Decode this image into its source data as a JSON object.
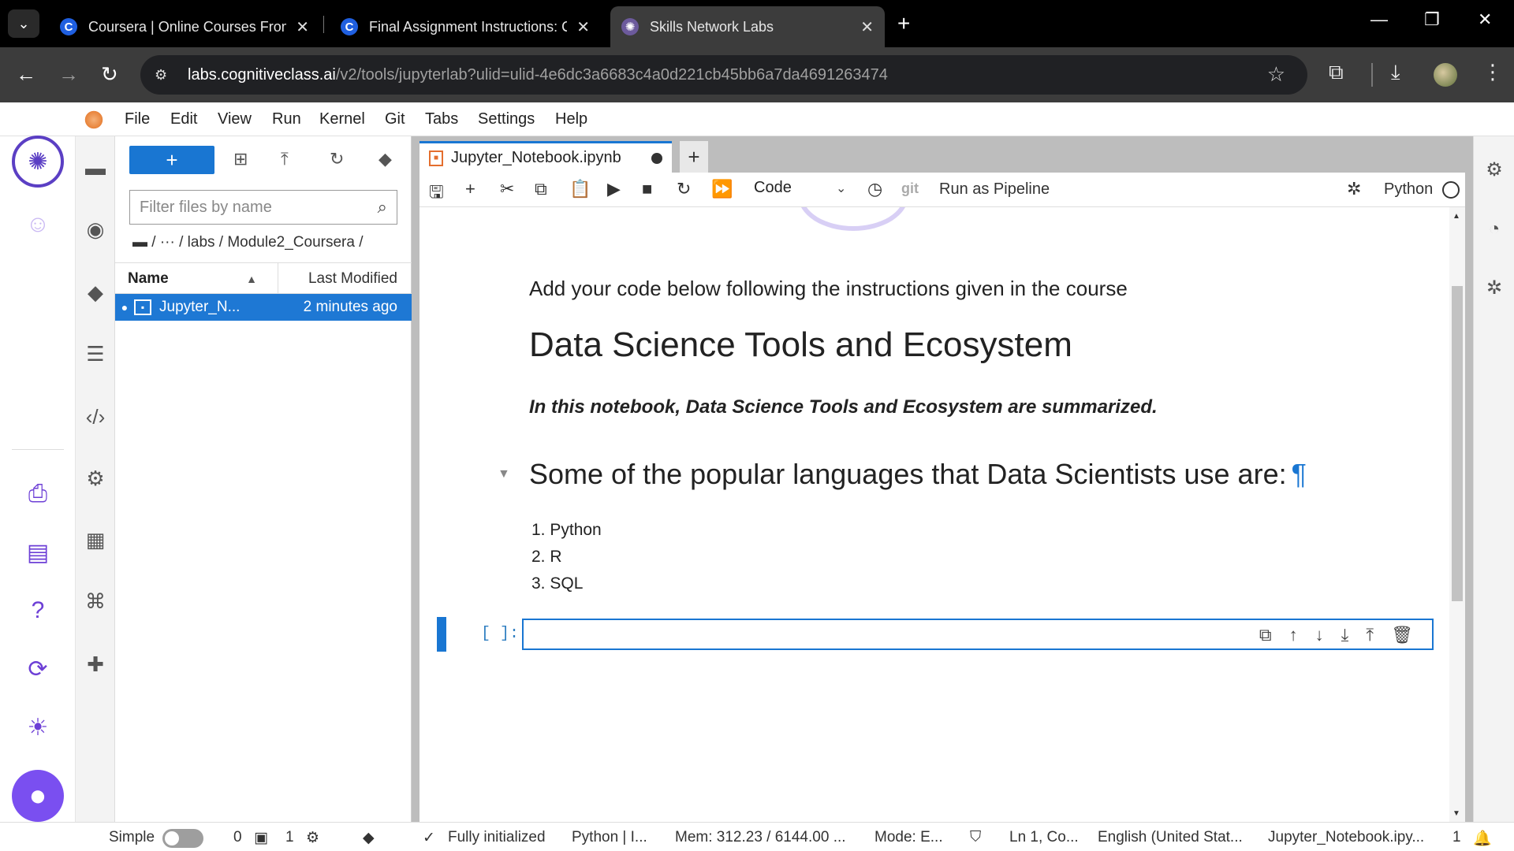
{
  "browser": {
    "tabs": [
      {
        "title": "Coursera | Online Courses From",
        "icon": "coursera-icon"
      },
      {
        "title": "Final Assignment Instructions: C",
        "icon": "coursera-icon"
      },
      {
        "title": "Skills Network Labs",
        "icon": "skills-network-icon"
      }
    ],
    "url_host": "labs.cognitiveclass.ai",
    "url_path": "/v2/tools/jupyterlab?ulid=ulid-4e6dc3a6683c4a0d221cb45bb6a7da4691263474"
  },
  "menu": [
    "File",
    "Edit",
    "View",
    "Run",
    "Kernel",
    "Git",
    "Tabs",
    "Settings",
    "Help"
  ],
  "filebrowser": {
    "new_label": "+",
    "filter_placeholder": "Filter files by name",
    "breadcrumb": "/  ···  /  labs  /  Module2_Coursera  /",
    "col_name": "Name",
    "col_modified": "Last Modified",
    "files": [
      {
        "name": "Jupyter_N...",
        "modified": "2 minutes ago"
      }
    ]
  },
  "notebook": {
    "tab_title": "Jupyter_Notebook.ipynb",
    "cell_type": "Code",
    "git_label": "git",
    "pipeline_label": "Run as Pipeline",
    "kernel_name": "Python",
    "intro": "Add your code below following the instructions given in the course",
    "title": "Data Science Tools and Ecosystem",
    "summary": "In this notebook, Data Science Tools and Ecosystem are summarized.",
    "languages_heading": "Some of the popular languages that Data Scientists use are:",
    "pilcrow": "¶",
    "languages": [
      "1. Python",
      "2. R",
      "3. SQL"
    ],
    "prompt": "[ ]:"
  },
  "status": {
    "mode_simple": "Simple",
    "terminals": "0",
    "kernels": "1",
    "init": "Fully initialized",
    "kernel_short": "Python | I...",
    "memory": "Mem: 312.23 / 6144.00 ...",
    "mode": "Mode: E...",
    "position": "Ln 1, Co...",
    "language": "English (United Stat...",
    "file": "Jupyter_Notebook.ipy...",
    "notifications": "1"
  },
  "colors": {
    "accent": "#1976d2",
    "brand_purple": "#6d3fd6"
  }
}
